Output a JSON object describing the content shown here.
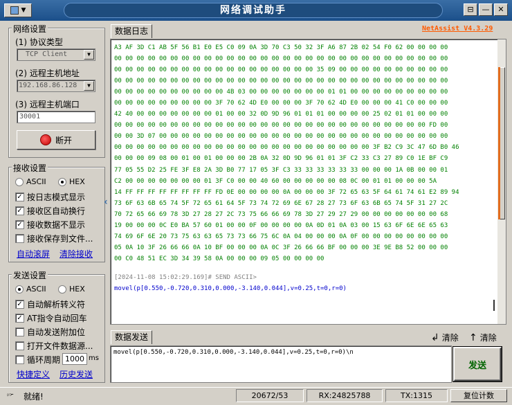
{
  "window": {
    "title": "网络调试助手",
    "controls": [
      "⊟",
      "—",
      "✕"
    ]
  },
  "net_settings": {
    "group_title": "网络设置",
    "protocol_label": "(1) 协议类型",
    "protocol_value": "TCP Client",
    "host_label": "(2) 远程主机地址",
    "host_value": "192.168.86.128",
    "port_label": "(3) 远程主机端口",
    "port_value": "30001",
    "disconnect_label": "断开"
  },
  "recv_settings": {
    "group_title": "接收设置",
    "ascii": "ASCII",
    "hex": "HEX",
    "options": [
      {
        "label": "按日志模式显示",
        "checked": true
      },
      {
        "label": "接收区自动换行",
        "checked": true
      },
      {
        "label": "接收数据不显示",
        "checked": true
      },
      {
        "label": "接收保存到文件...",
        "checked": false
      }
    ],
    "auto_scroll": "自动滚屏",
    "clear_recv": "清除接收"
  },
  "send_settings": {
    "group_title": "发送设置",
    "ascii": "ASCII",
    "hex": "HEX",
    "options": [
      {
        "label": "自动解析转义符",
        "checked": true
      },
      {
        "label": "AT指令自动回车",
        "checked": true
      },
      {
        "label": "自动发送附加位",
        "checked": false
      },
      {
        "label": "打开文件数据源...",
        "checked": false
      },
      {
        "label": "循环周期",
        "checked": false
      }
    ],
    "period_value": "1000",
    "period_unit": "ms",
    "shortcut": "快捷定义",
    "history": "历史发送"
  },
  "log": {
    "tab": "数据日志",
    "version": "NetAssist V4.3.29",
    "hex_lines": [
      "A3 AF 3D C1 AB 5F 56 B1 E0 E5 C0 09 0A 3D 70 C3 50 32 3F A6 87 2B 02 54 F0 62 00 00 00 00",
      "00 00 00 00 00 00 00 00 00 00 00 00 00 00 00 00 00 00 00 00 00 00 00 00 00 00 00 00 00 00",
      "00 00 00 00 00 00 00 00 00 00 00 00 00 00 00 00 00 00 35 09 00 00 00 00 00 00 00 00 00 00",
      "00 00 00 00 00 00 00 00 00 00 00 00 00 00 00 00 00 00 00 00 00 00 00 00 00 00 00 00 00 00",
      "00 00 00 00 00 00 00 00 00 00 4B 03 00 00 00 00 00 00 00 01 01 00 00 00 00 00 00 00 00 00",
      "00 00 00 00 00 00 00 00 00 3F 70 62 4D E0 00 00 00 3F 70 62 4D E0 00 00 00 41 C0 00 00 00",
      "42 40 00 00 00 00 00 00 00 01 00 00 32 0D 9D 96 01 01 01 00 00 00 00 25 02 01 01 00 00 00",
      "00 00 00 00 00 00 00 00 00 00 00 00 00 00 00 00 00 00 00 00 00 00 00 00 00 00 00 00 FD 00",
      "00 00 3D 07 00 00 00 00 00 00 00 00 00 00 00 00 00 00 00 00 00 00 00 00 00 00 00 00 00 00",
      "00 00 00 00 00 00 00 00 00 00 00 00 00 00 00 00 00 00 00 00 00 00 00 3F B2 C9 3C 47 6D B0 46",
      "00 00 00 09 08 00 01 00 01 00 00 00 2B 0A 32 0D 9D 96 01 01 3F C2 33 C3 27 89 C0 1E BF C9",
      "77 05 55 D2 25 FE 3F E8 2A 3D B0 77 17 05 3F C3 33 33 33 33 33 33 00 00 00 1A 0B 00 00 01",
      "C2 00 00 00 00 00 00 00 01 3F C0 00 00 40 60 00 00 00 00 00 08 0C 00 01 01 00 00 00 5A",
      "14 FF FF FF FF FF FF FF FF FD 0E 00 00 00 00 0A 00 00 00 3F 72 65 63 5F 64 61 74 61 E2 89 94",
      "73 6F 63 6B 65 74 5F 72 65 61 64 5F 73 74 72 69 6E 67 28 27 73 6F 63 6B 65 74 5F 31 27 2C",
      "70 72 65 66 69 78 3D 27 28 27 2C 73 75 66 66 69 78 3D 27 29 27 29 00 00 00 00 00 00 00 68",
      "19 00 00 00 0C E0 BA 57 60 01 00 00 0F 00 00 00 00 0A 0D 01 0A 03 00 15 63 6F 6E 6E 65 63",
      "74 69 6F 6E 20 73 75 63 63 65 73 73 66 75 6C 0A 04 00 00 00 0A 0F 00 00 00 00 00 00 00 00",
      "05 0A 10 3F 26 66 66 0A 10 BF 00 00 00 0A 0C 3F 26 66 66 BF 00 00 00 3E 9E B8 52 00 00 00",
      "00 C0 48 51 EC 3D 34 39 58 0A 00 00 00 09 05 00 00 00 00"
    ],
    "send_stamp": "[2024-11-08 15:02:29.169]# SEND ASCII>",
    "send_text": "movel(p[0.550,-0.720,0.310,0.000,-3.140,0.044],v=0.25,t=0,r=0)"
  },
  "send": {
    "tab": "数据发送",
    "clear1": "清除",
    "clear2": "清除",
    "text": "movel(p[0.550,-0.720,0.310,0.000,-3.140,0.044],v=0.25,t=0,r=0)\\n",
    "button": "发送"
  },
  "status": {
    "ready": "就绪!",
    "counts": "20672/53",
    "rx": "RX:24825788",
    "tx": "TX:1315",
    "reset": "复位计数"
  },
  "colors": {
    "hex_text": "#008000",
    "send_text": "#0000cc",
    "version": "#ff5a00",
    "title_bar": "#1b4f8a"
  }
}
